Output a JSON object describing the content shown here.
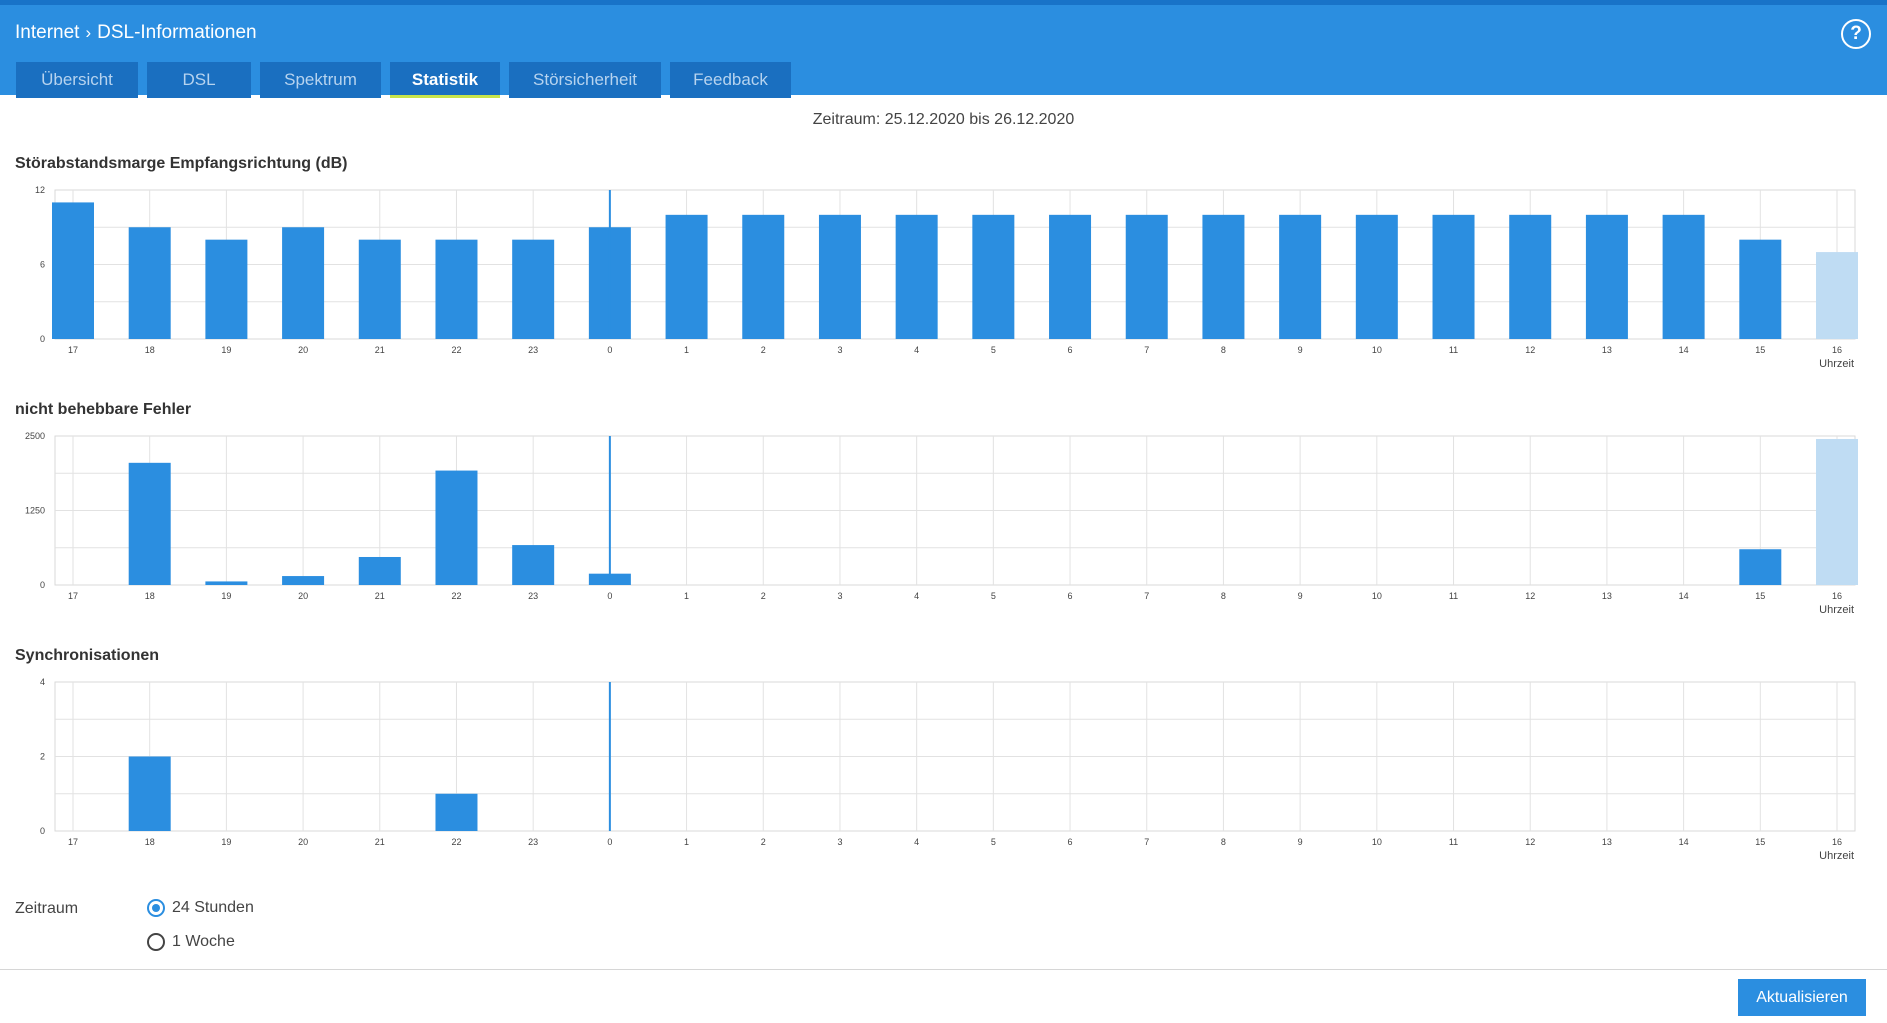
{
  "breadcrumb": {
    "root": "Internet",
    "page": "DSL-Informationen"
  },
  "help_icon": "?",
  "tabs": [
    "Übersicht",
    "DSL",
    "Spektrum",
    "Statistik",
    "Störsicherheit",
    "Feedback"
  ],
  "active_tab": "Statistik",
  "period_title": "Zeitraum: 25.12.2020 bis 26.12.2020",
  "colors": {
    "accent": "#2b8ee0",
    "current_hour_bar": "#bfdcf3",
    "header_tabs": "#1a6fc0",
    "active_tab_underline": "#c8e44a"
  },
  "chart_data": [
    {
      "type": "bar",
      "title": "Störabstandsmarge Empfangsrichtung (dB)",
      "xlabel": "Uhrzeit",
      "categories": [
        "17",
        "18",
        "19",
        "20",
        "21",
        "22",
        "23",
        "0",
        "1",
        "2",
        "3",
        "4",
        "5",
        "6",
        "7",
        "8",
        "9",
        "10",
        "11",
        "12",
        "13",
        "14",
        "15",
        "16"
      ],
      "values": [
        11,
        9,
        8,
        9,
        8,
        8,
        8,
        9,
        10,
        10,
        10,
        10,
        10,
        10,
        10,
        10,
        10,
        10,
        10,
        10,
        10,
        10,
        8,
        7
      ],
      "yticks": [
        "0",
        "6",
        "12"
      ],
      "ylim": [
        0,
        12
      ],
      "grid": true
    },
    {
      "type": "bar",
      "title": "nicht behebbare Fehler",
      "xlabel": "Uhrzeit",
      "categories": [
        "17",
        "18",
        "19",
        "20",
        "21",
        "22",
        "23",
        "0",
        "1",
        "2",
        "3",
        "4",
        "5",
        "6",
        "7",
        "8",
        "9",
        "10",
        "11",
        "12",
        "13",
        "14",
        "15",
        "16"
      ],
      "values": [
        0,
        2050,
        60,
        150,
        470,
        1920,
        670,
        190,
        0,
        0,
        0,
        0,
        0,
        0,
        0,
        0,
        0,
        0,
        0,
        0,
        0,
        0,
        600,
        2450
      ],
      "yticks": [
        "0",
        "1250",
        "2500"
      ],
      "ylim": [
        0,
        2500
      ],
      "grid": true
    },
    {
      "type": "bar",
      "title": "Synchronisationen",
      "xlabel": "Uhrzeit",
      "categories": [
        "17",
        "18",
        "19",
        "20",
        "21",
        "22",
        "23",
        "0",
        "1",
        "2",
        "3",
        "4",
        "5",
        "6",
        "7",
        "8",
        "9",
        "10",
        "11",
        "12",
        "13",
        "14",
        "15",
        "16"
      ],
      "values": [
        0,
        2,
        0,
        0,
        0,
        1,
        0,
        0,
        0,
        0,
        0,
        0,
        0,
        0,
        0,
        0,
        0,
        0,
        0,
        0,
        0,
        0,
        0,
        0
      ],
      "yticks": [
        "0",
        "2",
        "4"
      ],
      "ylim": [
        0,
        4
      ],
      "grid": true
    }
  ],
  "period_selector": {
    "label": "Zeitraum",
    "options": [
      "24 Stunden",
      "1 Woche"
    ],
    "selected": "24 Stunden"
  },
  "refresh_label": "Aktualisieren"
}
